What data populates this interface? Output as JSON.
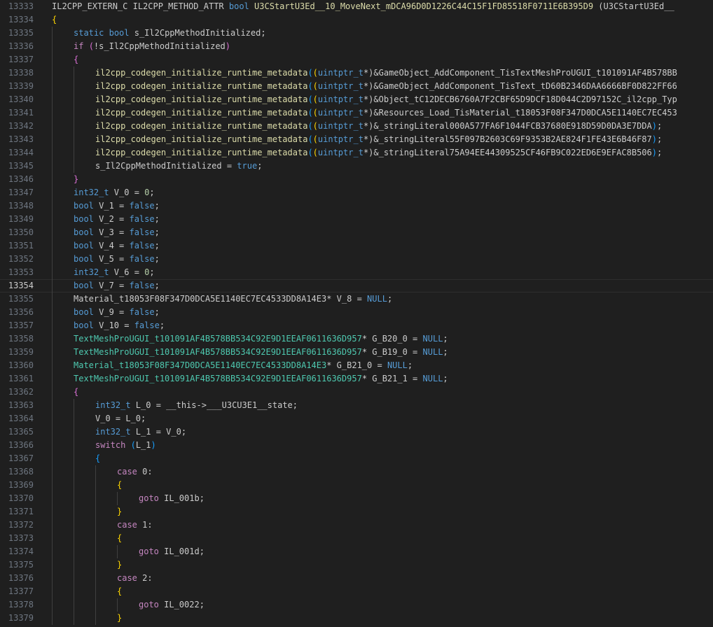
{
  "editor": {
    "lines": [
      {
        "n": "13333",
        "indent": 0,
        "current": false,
        "t": [
          [
            "IL2CPP_EXTERN_C IL2CPP_METHOD_ATTR ",
            "pl"
          ],
          [
            "bool",
            "kw"
          ],
          [
            " ",
            "pl"
          ],
          [
            "U3CStartU3Ed__10_MoveNext_mDCA96D0D1226C44C15F1FD85518F0711E6B395D9",
            "fn"
          ],
          [
            " (U3CStartU3Ed__",
            "pl"
          ]
        ]
      },
      {
        "n": "13334",
        "indent": 0,
        "current": false,
        "t": [
          [
            "{",
            "br1"
          ]
        ]
      },
      {
        "n": "13335",
        "indent": 1,
        "current": false,
        "t": [
          [
            "static",
            "kw"
          ],
          [
            " ",
            "pl"
          ],
          [
            "bool",
            "kw"
          ],
          [
            " s_Il2CppMethodInitialized;",
            "pl"
          ]
        ]
      },
      {
        "n": "13336",
        "indent": 1,
        "current": false,
        "t": [
          [
            "if",
            "ctl"
          ],
          [
            " ",
            "pl"
          ],
          [
            "(",
            "br2"
          ],
          [
            "!s_Il2CppMethodInitialized",
            "pl"
          ],
          [
            ")",
            "br2"
          ]
        ]
      },
      {
        "n": "13337",
        "indent": 1,
        "current": false,
        "t": [
          [
            "{",
            "br2"
          ]
        ]
      },
      {
        "n": "13338",
        "indent": 2,
        "current": false,
        "t": [
          [
            "il2cpp_codegen_initialize_runtime_metadata",
            "fn"
          ],
          [
            "(",
            "br3"
          ],
          [
            "(",
            "br1"
          ],
          [
            "uintptr_t",
            "kw"
          ],
          [
            "*)",
            "pl"
          ],
          [
            "&GameObject_AddComponent_TisTextMeshProUGUI_t101091AF4B578BB",
            "pl"
          ]
        ]
      },
      {
        "n": "13339",
        "indent": 2,
        "current": false,
        "t": [
          [
            "il2cpp_codegen_initialize_runtime_metadata",
            "fn"
          ],
          [
            "(",
            "br3"
          ],
          [
            "(",
            "br1"
          ],
          [
            "uintptr_t",
            "kw"
          ],
          [
            "*)",
            "pl"
          ],
          [
            "&GameObject_AddComponent_TisText_tD60B2346DAA6666BF0D822FF66",
            "pl"
          ]
        ]
      },
      {
        "n": "13340",
        "indent": 2,
        "current": false,
        "t": [
          [
            "il2cpp_codegen_initialize_runtime_metadata",
            "fn"
          ],
          [
            "(",
            "br3"
          ],
          [
            "(",
            "br1"
          ],
          [
            "uintptr_t",
            "kw"
          ],
          [
            "*)",
            "pl"
          ],
          [
            "&Object_tC12DECB6760A7F2CBF65D9DCF18D044C2D97152C_il2cpp_Typ",
            "pl"
          ]
        ]
      },
      {
        "n": "13341",
        "indent": 2,
        "current": false,
        "t": [
          [
            "il2cpp_codegen_initialize_runtime_metadata",
            "fn"
          ],
          [
            "(",
            "br3"
          ],
          [
            "(",
            "br1"
          ],
          [
            "uintptr_t",
            "kw"
          ],
          [
            "*)",
            "pl"
          ],
          [
            "&Resources_Load_TisMaterial_t18053F08F347D0DCA5E1140EC7EC453",
            "pl"
          ]
        ]
      },
      {
        "n": "13342",
        "indent": 2,
        "current": false,
        "t": [
          [
            "il2cpp_codegen_initialize_runtime_metadata",
            "fn"
          ],
          [
            "(",
            "br3"
          ],
          [
            "(",
            "br1"
          ],
          [
            "uintptr_t",
            "kw"
          ],
          [
            "*)",
            "pl"
          ],
          [
            "&_stringLiteral000A577FA6F1044FCB37680E918D59D0DA3E7DDA",
            ""
          ],
          [
            ")",
            "br3"
          ],
          [
            ";",
            "pl"
          ]
        ]
      },
      {
        "n": "13343",
        "indent": 2,
        "current": false,
        "t": [
          [
            "il2cpp_codegen_initialize_runtime_metadata",
            "fn"
          ],
          [
            "(",
            "br3"
          ],
          [
            "(",
            "br1"
          ],
          [
            "uintptr_t",
            "kw"
          ],
          [
            "*)",
            "pl"
          ],
          [
            "&_stringLiteral55F097B2603C69F9353B2AE824F1FE43E6B46F87",
            "pl"
          ],
          [
            ")",
            "br3"
          ],
          [
            ";",
            "pl"
          ]
        ]
      },
      {
        "n": "13344",
        "indent": 2,
        "current": false,
        "t": [
          [
            "il2cpp_codegen_initialize_runtime_metadata",
            "fn"
          ],
          [
            "(",
            "br3"
          ],
          [
            "(",
            "br1"
          ],
          [
            "uintptr_t",
            "kw"
          ],
          [
            "*)",
            "pl"
          ],
          [
            "&_stringLiteral75A94EE44309525CF46FB9C022ED6E9EFAC8B506",
            "pl"
          ],
          [
            ")",
            "br3"
          ],
          [
            ";",
            "pl"
          ]
        ]
      },
      {
        "n": "13345",
        "indent": 2,
        "current": false,
        "t": [
          [
            "s_Il2CppMethodInitialized = ",
            "pl"
          ],
          [
            "true",
            "kw"
          ],
          [
            ";",
            "pl"
          ]
        ]
      },
      {
        "n": "13346",
        "indent": 1,
        "current": false,
        "t": [
          [
            "}",
            "br2"
          ]
        ]
      },
      {
        "n": "13347",
        "indent": 1,
        "current": false,
        "t": [
          [
            "int32_t",
            "kw"
          ],
          [
            " V_0 = ",
            "pl"
          ],
          [
            "0",
            "num"
          ],
          [
            ";",
            "pl"
          ]
        ]
      },
      {
        "n": "13348",
        "indent": 1,
        "current": false,
        "t": [
          [
            "bool",
            "kw"
          ],
          [
            " V_1 = ",
            "pl"
          ],
          [
            "false",
            "kw"
          ],
          [
            ";",
            "pl"
          ]
        ]
      },
      {
        "n": "13349",
        "indent": 1,
        "current": false,
        "t": [
          [
            "bool",
            "kw"
          ],
          [
            " V_2 = ",
            "pl"
          ],
          [
            "false",
            "kw"
          ],
          [
            ";",
            "pl"
          ]
        ]
      },
      {
        "n": "13350",
        "indent": 1,
        "current": false,
        "t": [
          [
            "bool",
            "kw"
          ],
          [
            " V_3 = ",
            "pl"
          ],
          [
            "false",
            "kw"
          ],
          [
            ";",
            "pl"
          ]
        ]
      },
      {
        "n": "13351",
        "indent": 1,
        "current": false,
        "t": [
          [
            "bool",
            "kw"
          ],
          [
            " V_4 = ",
            "pl"
          ],
          [
            "false",
            "kw"
          ],
          [
            ";",
            "pl"
          ]
        ]
      },
      {
        "n": "13352",
        "indent": 1,
        "current": false,
        "t": [
          [
            "bool",
            "kw"
          ],
          [
            " V_5 = ",
            "pl"
          ],
          [
            "false",
            "kw"
          ],
          [
            ";",
            "pl"
          ]
        ]
      },
      {
        "n": "13353",
        "indent": 1,
        "current": false,
        "t": [
          [
            "int32_t",
            "kw"
          ],
          [
            " V_6 = ",
            "pl"
          ],
          [
            "0",
            "num"
          ],
          [
            ";",
            "pl"
          ]
        ]
      },
      {
        "n": "13354",
        "indent": 1,
        "current": true,
        "t": [
          [
            "bool",
            "kw"
          ],
          [
            " V_7 = ",
            "pl"
          ],
          [
            "false",
            "kw"
          ],
          [
            ";",
            "pl"
          ]
        ]
      },
      {
        "n": "13355",
        "indent": 1,
        "current": false,
        "t": [
          [
            "Material_t18053F08F347D0DCA5E1140EC7EC4533DD8A14E3",
            "pl"
          ],
          [
            "* V_8 = ",
            "pl"
          ],
          [
            "NULL",
            "kw"
          ],
          [
            ";",
            "pl"
          ]
        ]
      },
      {
        "n": "13356",
        "indent": 1,
        "current": false,
        "t": [
          [
            "bool",
            "kw"
          ],
          [
            " V_9 = ",
            "pl"
          ],
          [
            "false",
            "kw"
          ],
          [
            ";",
            "pl"
          ]
        ]
      },
      {
        "n": "13357",
        "indent": 1,
        "current": false,
        "t": [
          [
            "bool",
            "kw"
          ],
          [
            " V_10 = ",
            "pl"
          ],
          [
            "false",
            "kw"
          ],
          [
            ";",
            "pl"
          ]
        ]
      },
      {
        "n": "13358",
        "indent": 1,
        "current": false,
        "t": [
          [
            "TextMeshProUGUI_t101091AF4B578BB534C92E9D1EEAF0611636D957",
            "ty"
          ],
          [
            "* G_B20_0 = ",
            "pl"
          ],
          [
            "NULL",
            "kw"
          ],
          [
            ";",
            "pl"
          ]
        ]
      },
      {
        "n": "13359",
        "indent": 1,
        "current": false,
        "t": [
          [
            "TextMeshProUGUI_t101091AF4B578BB534C92E9D1EEAF0611636D957",
            "ty"
          ],
          [
            "* G_B19_0 = ",
            "pl"
          ],
          [
            "NULL",
            "kw"
          ],
          [
            ";",
            "pl"
          ]
        ]
      },
      {
        "n": "13360",
        "indent": 1,
        "current": false,
        "t": [
          [
            "Material_t18053F08F347D0DCA5E1140EC7EC4533DD8A14E3",
            "ty"
          ],
          [
            "* G_B21_0 = ",
            "pl"
          ],
          [
            "NULL",
            "kw"
          ],
          [
            ";",
            "pl"
          ]
        ]
      },
      {
        "n": "13361",
        "indent": 1,
        "current": false,
        "t": [
          [
            "TextMeshProUGUI_t101091AF4B578BB534C92E9D1EEAF0611636D957",
            "ty"
          ],
          [
            "* G_B21_1 = ",
            "pl"
          ],
          [
            "NULL",
            "kw"
          ],
          [
            ";",
            "pl"
          ]
        ]
      },
      {
        "n": "13362",
        "indent": 1,
        "current": false,
        "t": [
          [
            "{",
            "br2"
          ]
        ]
      },
      {
        "n": "13363",
        "indent": 2,
        "current": false,
        "t": [
          [
            "int32_t",
            "kw"
          ],
          [
            " L_0 = __this->___U3CU3E1__state;",
            "pl"
          ]
        ]
      },
      {
        "n": "13364",
        "indent": 2,
        "current": false,
        "t": [
          [
            "V_0 = L_0;",
            "pl"
          ]
        ]
      },
      {
        "n": "13365",
        "indent": 2,
        "current": false,
        "t": [
          [
            "int32_t",
            "kw"
          ],
          [
            " L_1 = V_0;",
            "pl"
          ]
        ]
      },
      {
        "n": "13366",
        "indent": 2,
        "current": false,
        "t": [
          [
            "switch",
            "ctl"
          ],
          [
            " ",
            "pl"
          ],
          [
            "(",
            "br3"
          ],
          [
            "L_1",
            "pl"
          ],
          [
            ")",
            "br3"
          ]
        ]
      },
      {
        "n": "13367",
        "indent": 2,
        "current": false,
        "t": [
          [
            "{",
            "br3"
          ]
        ]
      },
      {
        "n": "13368",
        "indent": 3,
        "current": false,
        "t": [
          [
            "case",
            "ctl"
          ],
          [
            " 0:",
            "pl"
          ]
        ]
      },
      {
        "n": "13369",
        "indent": 3,
        "current": false,
        "t": [
          [
            "{",
            "br1"
          ]
        ]
      },
      {
        "n": "13370",
        "indent": 4,
        "current": false,
        "t": [
          [
            "goto",
            "ctl"
          ],
          [
            " IL_001b;",
            "pl"
          ]
        ]
      },
      {
        "n": "13371",
        "indent": 3,
        "current": false,
        "t": [
          [
            "}",
            "br1"
          ]
        ]
      },
      {
        "n": "13372",
        "indent": 3,
        "current": false,
        "t": [
          [
            "case",
            "ctl"
          ],
          [
            " 1:",
            "pl"
          ]
        ]
      },
      {
        "n": "13373",
        "indent": 3,
        "current": false,
        "t": [
          [
            "{",
            "br1"
          ]
        ]
      },
      {
        "n": "13374",
        "indent": 4,
        "current": false,
        "t": [
          [
            "goto",
            "ctl"
          ],
          [
            " IL_001d;",
            "pl"
          ]
        ]
      },
      {
        "n": "13375",
        "indent": 3,
        "current": false,
        "t": [
          [
            "}",
            "br1"
          ]
        ]
      },
      {
        "n": "13376",
        "indent": 3,
        "current": false,
        "t": [
          [
            "case",
            "ctl"
          ],
          [
            " 2:",
            "pl"
          ]
        ]
      },
      {
        "n": "13377",
        "indent": 3,
        "current": false,
        "t": [
          [
            "{",
            "br1"
          ]
        ]
      },
      {
        "n": "13378",
        "indent": 4,
        "current": false,
        "t": [
          [
            "goto",
            "ctl"
          ],
          [
            " IL_0022;",
            "pl"
          ]
        ]
      },
      {
        "n": "13379",
        "indent": 3,
        "current": false,
        "t": [
          [
            "}",
            "br1"
          ]
        ]
      }
    ]
  }
}
